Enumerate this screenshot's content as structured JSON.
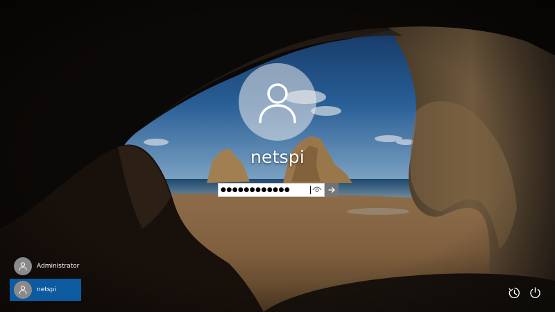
{
  "user": {
    "name": "netspi",
    "password_masked": "●●●●●●●●●●●●"
  },
  "accounts": [
    {
      "name": "Administrator",
      "selected": false
    },
    {
      "name": "netspi",
      "selected": true
    }
  ],
  "icons": {
    "avatar": "person-icon",
    "reveal": "eye-icon",
    "submit": "arrow-right-icon",
    "ease_of_access": "ease-of-access-icon",
    "power": "power-icon"
  },
  "colors": {
    "selected_account": "#0c5a9f",
    "text": "#ffffff"
  }
}
